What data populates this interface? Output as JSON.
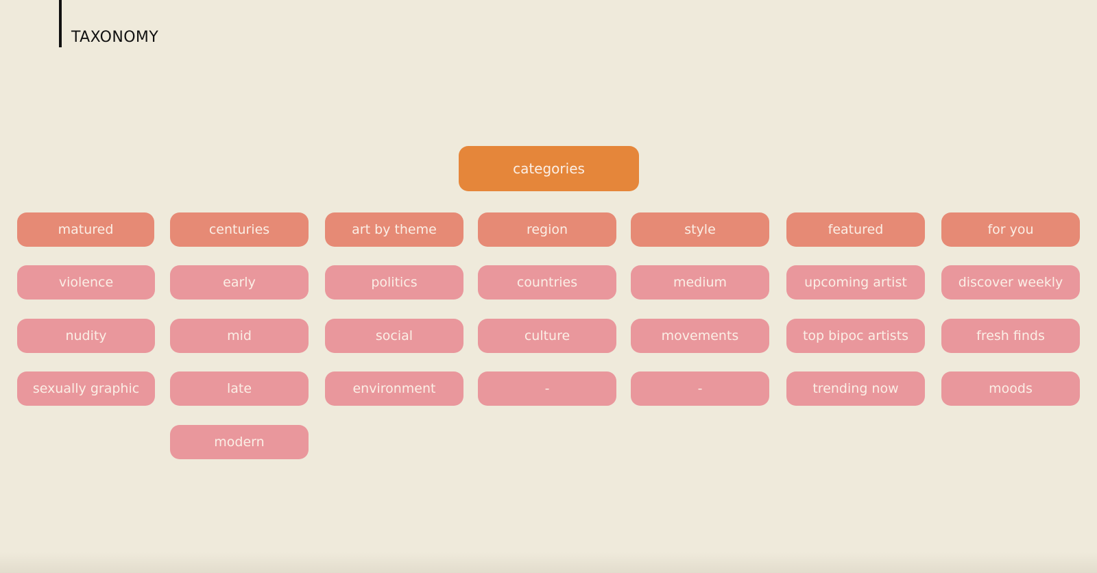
{
  "page": {
    "title": "TAXONOMY"
  },
  "root": {
    "label": "categories"
  },
  "columns": [
    {
      "label": "matured",
      "items": [
        "violence",
        "nudity",
        "sexually graphic"
      ]
    },
    {
      "label": "centuries",
      "items": [
        "early",
        "mid",
        "late",
        "modern"
      ]
    },
    {
      "label": "art by theme",
      "items": [
        "politics",
        "social",
        "environment"
      ]
    },
    {
      "label": "region",
      "items": [
        "countries",
        "culture",
        "-"
      ]
    },
    {
      "label": "style",
      "items": [
        "medium",
        "movements",
        "-"
      ]
    },
    {
      "label": "featured",
      "items": [
        "upcoming artist",
        "top bipoc artists",
        "trending now"
      ]
    },
    {
      "label": "for you",
      "items": [
        "discover weekly",
        "fresh finds",
        "moods"
      ]
    }
  ],
  "colors": {
    "background": "#EFEADB",
    "root_fill": "#E5863A",
    "category_fill": "#E68A75",
    "subitem_fill": "#E9979C",
    "pill_text": "#FBEFE6",
    "title_text": "#111111"
  }
}
